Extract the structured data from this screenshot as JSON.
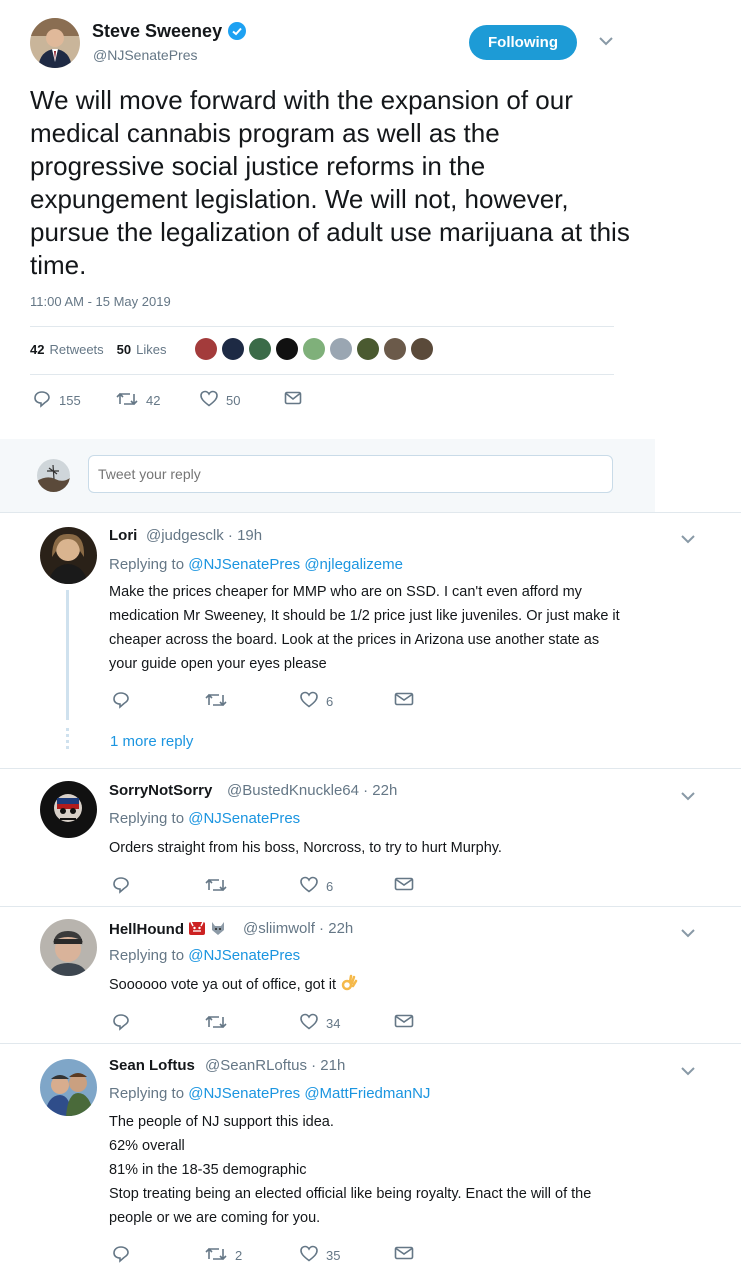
{
  "main_tweet": {
    "name": "Steve Sweeney",
    "handle": "@NJSenatePres",
    "follow_label": "Following",
    "text": "We will move forward with the expansion of our medical cannabis program as well as the progressive social justice reforms in the expungement legislation. We will not, however, pursue the legalization of adult use marijuana at this time.",
    "timestamp": "11:00 AM - 15 May 2019",
    "retweets_count": "42",
    "retweets_label": "Retweets",
    "likes_count": "50",
    "likes_label": "Likes",
    "actions": {
      "replies": "155",
      "retweets": "42",
      "likes": "50"
    }
  },
  "composer": {
    "placeholder": "Tweet your reply"
  },
  "replies": [
    {
      "name": "Lori",
      "meta": "@judgesclk · 19h",
      "replying_label": "Replying to",
      "replying_to": "@NJSenatePres @njlegalizeme",
      "lines": [
        "Make the prices cheaper for MMP who are on SSD.  I can't even afford my",
        "medication Mr Sweeney, It should be 1/2 price just like juveniles.  Or just make it",
        "cheaper across the board.   Look at the prices in Arizona use another state as",
        "your guide open your eyes please"
      ],
      "retweets": "",
      "likes": "6",
      "more_replies": "1 more reply"
    },
    {
      "name": "SorryNotSorry",
      "meta": "@BustedKnuckle64 · 22h",
      "replying_label": "Replying to",
      "replying_to": "@NJSenatePres",
      "lines": [
        "Orders straight from his boss, Norcross, to try to hurt Murphy."
      ],
      "retweets": "",
      "likes": "6"
    },
    {
      "name": "HellHound",
      "meta": "@sliimwolf · 22h",
      "replying_label": "Replying to",
      "replying_to": "@NJSenatePres",
      "lines": [
        "Soooooo vote ya out of office, got it"
      ],
      "retweets": "",
      "likes": "34"
    },
    {
      "name": "Sean Loftus",
      "meta": "@SeanRLoftus · 21h",
      "replying_label": "Replying to",
      "replying_to": "@NJSenatePres @MattFriedmanNJ",
      "lines": [
        "The people of NJ support this idea.",
        "62% overall",
        "81% in the 18-35 demographic",
        "Stop treating being an elected official like being royalty. Enact the will of the",
        "people or we are coming for you."
      ],
      "retweets": "2",
      "likes": "35"
    }
  ],
  "colors": {
    "accent": "#1b95e0",
    "muted": "#657786",
    "border": "#e1e8ed",
    "button": "#1d9bd6"
  },
  "liker_colors": [
    "#a33b3b",
    "#1d2a44",
    "#3b6b48",
    "#111111",
    "#7fb07a",
    "#9aa6b2",
    "#4a5a30",
    "#6b5a4a",
    "#5a4a3a"
  ]
}
